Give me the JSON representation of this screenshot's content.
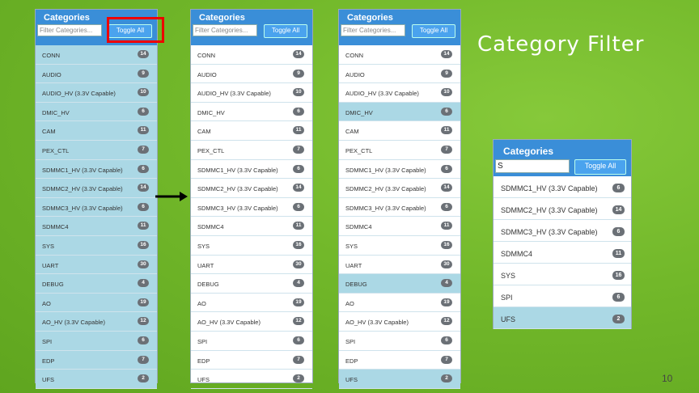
{
  "slide": {
    "title": "Category Filter",
    "page_number": "10"
  },
  "panel": {
    "title": "Categories",
    "filter_placeholder": "Filter Categories...",
    "toggle_label": "Toggle All"
  },
  "categories": [
    {
      "label": "CONN",
      "count": "14"
    },
    {
      "label": "AUDIO",
      "count": "9"
    },
    {
      "label": "AUDIO_HV (3.3V Capable)",
      "count": "10"
    },
    {
      "label": "DMIC_HV",
      "count": "6"
    },
    {
      "label": "CAM",
      "count": "11"
    },
    {
      "label": "PEX_CTL",
      "count": "7"
    },
    {
      "label": "SDMMC1_HV (3.3V Capable)",
      "count": "6"
    },
    {
      "label": "SDMMC2_HV (3.3V Capable)",
      "count": "14"
    },
    {
      "label": "SDMMC3_HV (3.3V Capable)",
      "count": "6"
    },
    {
      "label": "SDMMC4",
      "count": "11"
    },
    {
      "label": "SYS",
      "count": "16"
    },
    {
      "label": "UART",
      "count": "30"
    },
    {
      "label": "DEBUG",
      "count": "4"
    },
    {
      "label": "AO",
      "count": "19"
    },
    {
      "label": "AO_HV (3.3V Capable)",
      "count": "12"
    },
    {
      "label": "SPI",
      "count": "6"
    },
    {
      "label": "EDP",
      "count": "7"
    },
    {
      "label": "UFS",
      "count": "2"
    }
  ],
  "filtered_panel": {
    "filter_value": "S",
    "rows": [
      {
        "label": "SDMMC1_HV (3.3V Capable)",
        "count": "6"
      },
      {
        "label": "SDMMC2_HV (3.3V Capable)",
        "count": "14"
      },
      {
        "label": "SDMMC3_HV (3.3V Capable)",
        "count": "6"
      },
      {
        "label": "SDMMC4",
        "count": "11"
      },
      {
        "label": "SYS",
        "count": "16"
      },
      {
        "label": "SPI",
        "count": "6"
      },
      {
        "label": "UFS",
        "count": "2"
      }
    ]
  },
  "colors": {
    "background": "#72b82a",
    "header": "#3a8ed8",
    "selected_row": "#abd8e5",
    "highlight_box": "#ee0000"
  }
}
